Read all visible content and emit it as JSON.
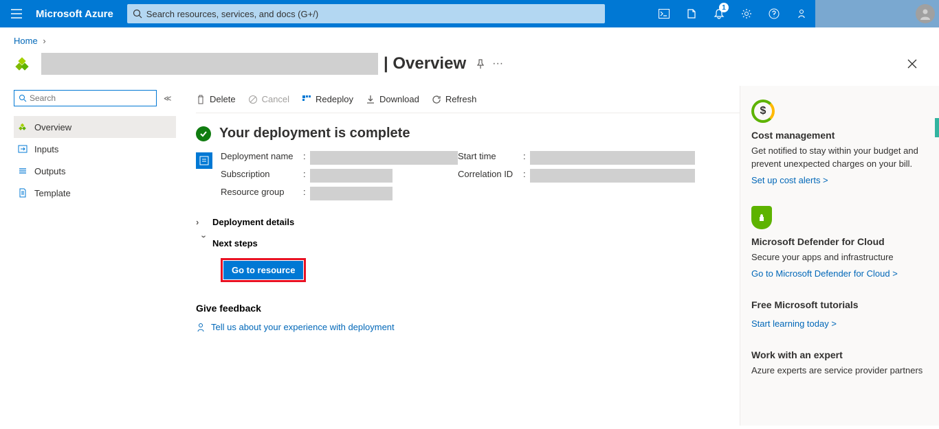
{
  "header": {
    "brand": "Microsoft Azure",
    "search_placeholder": "Search resources, services, and docs (G+/)",
    "notif_count": "1"
  },
  "breadcrumb": {
    "items": [
      "Home"
    ]
  },
  "page": {
    "title_suffix": "| Overview",
    "subtype": "Deployment"
  },
  "sidebar": {
    "search_placeholder": "Search",
    "items": [
      {
        "label": "Overview",
        "icon": "overview"
      },
      {
        "label": "Inputs",
        "icon": "inputs"
      },
      {
        "label": "Outputs",
        "icon": "outputs"
      },
      {
        "label": "Template",
        "icon": "template"
      }
    ]
  },
  "toolbar": {
    "delete": "Delete",
    "cancel": "Cancel",
    "redeploy": "Redeploy",
    "download": "Download",
    "refresh": "Refresh"
  },
  "status": {
    "heading": "Your deployment is complete",
    "fields": {
      "deployment_name": "Deployment name",
      "subscription": "Subscription",
      "resource_group": "Resource group",
      "start_time": "Start time",
      "correlation_id": "Correlation ID"
    },
    "colon": ":"
  },
  "sections": {
    "deployment_details": "Deployment details",
    "next_steps": "Next steps",
    "go_to_resource": "Go to resource",
    "feedback_heading": "Give feedback",
    "feedback_link": "Tell us about your experience with deployment"
  },
  "right": {
    "cost": {
      "title": "Cost management",
      "text": "Get notified to stay within your budget and prevent unexpected charges on your bill.",
      "link": "Set up cost alerts >"
    },
    "defender": {
      "title": "Microsoft Defender for Cloud",
      "text": "Secure your apps and infrastructure",
      "link": "Go to Microsoft Defender for Cloud >"
    },
    "tutorials": {
      "title": "Free Microsoft tutorials",
      "link": "Start learning today >"
    },
    "expert": {
      "title": "Work with an expert",
      "text": "Azure experts are service provider partners"
    }
  }
}
